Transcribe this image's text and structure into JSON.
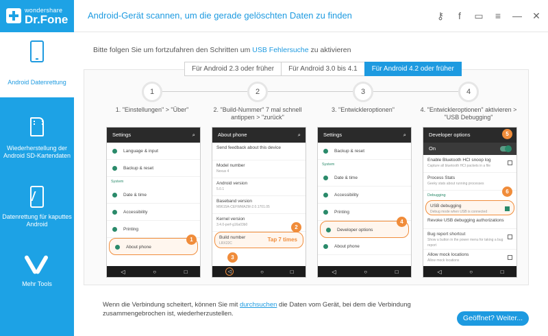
{
  "app": {
    "brand_small": "wondershare",
    "brand_big": "Dr.Fone",
    "title": "Android-Gerät scannen, um die gerade gelöschten Daten zu finden"
  },
  "top_icons": [
    {
      "name": "key-icon",
      "glyph": "⚷"
    },
    {
      "name": "facebook-icon",
      "glyph": "f"
    },
    {
      "name": "chat-icon",
      "glyph": "▭"
    },
    {
      "name": "menu-icon",
      "glyph": "≡"
    },
    {
      "name": "minimize-icon",
      "glyph": "—"
    },
    {
      "name": "close-icon",
      "glyph": "✕"
    }
  ],
  "sidebar": {
    "items": [
      {
        "label": "Android Datenrettung",
        "icon": "phone-icon"
      },
      {
        "label": "Wiederherstellung der Android SD-Kartendaten",
        "icon": "sd-card-icon"
      },
      {
        "label": "Datenrettung für kaputtes Android",
        "icon": "broken-phone-icon"
      },
      {
        "label": "Mehr Tools",
        "icon": "tools-icon"
      }
    ]
  },
  "instruction": {
    "prefix": "Bitte folgen Sie um fortzufahren den Schritten um ",
    "link": "USB Fehlersuche",
    "suffix": " zu aktivieren"
  },
  "tabs": [
    "Für Android 2.3 oder früher",
    "Für Android 3.0 bis 4.1",
    "Für Android 4.2 oder früher"
  ],
  "steps": [
    {
      "num": "1",
      "text": "1. \"Einstellungen\" > \"Über\""
    },
    {
      "num": "2",
      "text": "2. \"Build-Nummer\" 7 mal schnell antippen > \"zurück\""
    },
    {
      "num": "3",
      "text": "3. \"Entwickleroptionen\""
    },
    {
      "num": "4",
      "text": "4. \"Entwickleroptionen\" aktivieren > \"USB Debugging\""
    }
  ],
  "phones": {
    "p1": {
      "header": "Settings",
      "rows": [
        "Language & input",
        "Backup & reset"
      ],
      "section": "System",
      "rows2": [
        "Date & time",
        "Accessibility",
        "Printing",
        "About phone"
      ]
    },
    "p2": {
      "header": "About phone",
      "rows": [
        {
          "t": "Send feedback about this device",
          "s": ""
        },
        {
          "t": "Model number",
          "s": "Nexus 4"
        },
        {
          "t": "Android version",
          "s": "5.0.1"
        },
        {
          "t": "Baseband version",
          "s": "M9615A-CEFWMAZM-2.0.1701.05"
        },
        {
          "t": "Kernel version",
          "s": "3.4.0-perf-g16a03b0"
        },
        {
          "t": "Build number",
          "s": "LRX22C"
        }
      ],
      "tap": "Tap 7 times"
    },
    "p3": {
      "header": "Settings",
      "rows": [
        "Backup & reset"
      ],
      "section": "System",
      "rows2": [
        "Date & time",
        "Accessibility",
        "Printing",
        "Developer options",
        "About phone"
      ]
    },
    "p4": {
      "header": "Developer options",
      "on": "On",
      "rows": [
        {
          "t": "Enable Bluetooth HCI snoop log",
          "s": "Capture all bluetooth HCI packets in a file"
        },
        {
          "t": "Process Stats",
          "s": "Geeky stats about running processes"
        }
      ],
      "section": "Debugging",
      "rows2": [
        {
          "t": "USB debugging",
          "s": "Debug mode when USB is connected"
        },
        {
          "t": "Revoke USB debugging authorizations",
          "s": ""
        },
        {
          "t": "Bug report shortcut",
          "s": "Show a button in the power menu for taking a bug report"
        },
        {
          "t": "Allow mock locations",
          "s": "Allow mock locations"
        }
      ]
    }
  },
  "badges": [
    "1",
    "2",
    "3",
    "4",
    "5",
    "6"
  ],
  "nav": {
    "back": "◁",
    "home": "○",
    "recent": "□"
  },
  "bottom": {
    "prefix": "Wenn die Verbindung scheitert, können Sie mit ",
    "link": "durchsuchen",
    "suffix": " die Daten vom Gerät, bei dem die Verbindung zusammengebrochen ist, wiederherzustellen."
  },
  "next_button": "Geöffnet? Weiter..."
}
